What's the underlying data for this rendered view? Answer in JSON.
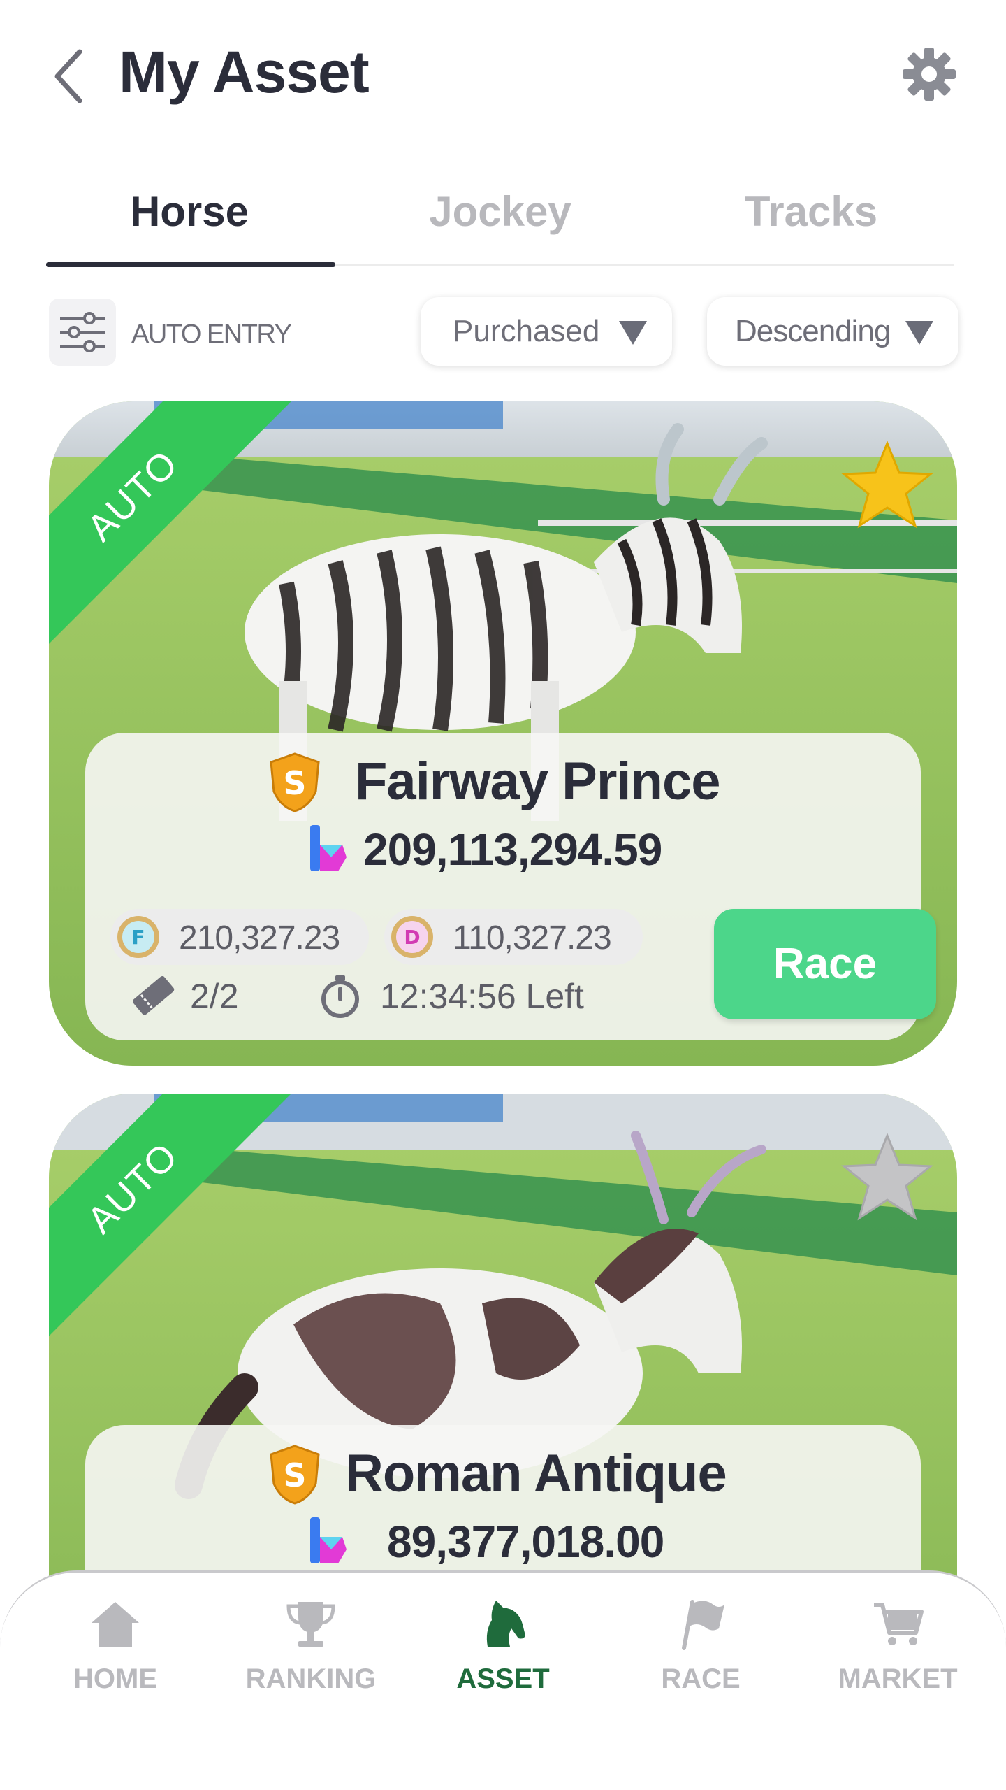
{
  "header": {
    "title": "My Asset",
    "back_icon": "chevron-left-icon",
    "settings_icon": "gear-icon"
  },
  "tabs": [
    {
      "label": "Horse",
      "active": true
    },
    {
      "label": "Jockey",
      "active": false
    },
    {
      "label": "Tracks",
      "active": false
    }
  ],
  "filter": {
    "auto_entry_label": "AUTO ENTRY",
    "sort_by": "Purchased",
    "order": "Descending"
  },
  "cards": [
    {
      "ribbon": "AUTO",
      "favorite": true,
      "grade": "S",
      "name": "Fairway Prince",
      "price": "209,113,294.59",
      "coin_f": {
        "letter": "F",
        "value": "210,327.23"
      },
      "coin_d": {
        "letter": "D",
        "value": "110,327.23"
      },
      "tickets": "2/2",
      "time_left": "12:34:56",
      "time_left_suffix": "Left",
      "race_label": "Race"
    },
    {
      "ribbon": "AUTO",
      "favorite": false,
      "grade": "S",
      "name": "Roman Antique",
      "price": "89,377,018.00"
    }
  ],
  "nav": [
    {
      "label": "HOME",
      "icon": "home-icon",
      "active": false
    },
    {
      "label": "RANKING",
      "icon": "trophy-icon",
      "active": false
    },
    {
      "label": "ASSET",
      "icon": "horse-head-icon",
      "active": true
    },
    {
      "label": "RACE",
      "icon": "flag-icon",
      "active": false
    },
    {
      "label": "MARKET",
      "icon": "cart-icon",
      "active": false
    }
  ],
  "colors": {
    "accent_green": "#34c759",
    "race_button": "#4cd68a",
    "active_nav": "#1f6b3c",
    "star_gold": "#f7c31a",
    "text_dark": "#2b2d3a"
  }
}
